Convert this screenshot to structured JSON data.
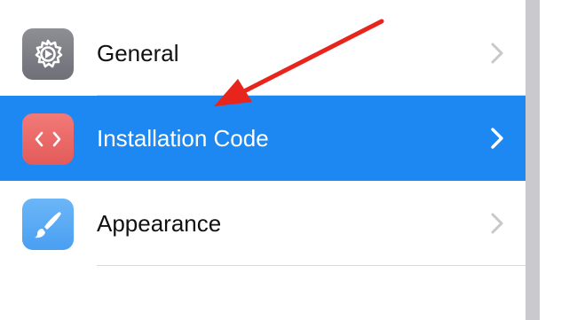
{
  "settings_menu": {
    "items": [
      {
        "label": "General",
        "icon": "gear-icon",
        "selected": false
      },
      {
        "label": "Installation Code",
        "icon": "code-brackets-icon",
        "selected": true
      },
      {
        "label": "Appearance",
        "icon": "paintbrush-icon",
        "selected": false
      }
    ]
  },
  "colors": {
    "selection": "#1e88f2",
    "annotation_arrow": "#e8251c",
    "general_icon": "#7f7f86",
    "code_icon": "#ea6b69",
    "appearance_icon": "#5aa9f4"
  }
}
